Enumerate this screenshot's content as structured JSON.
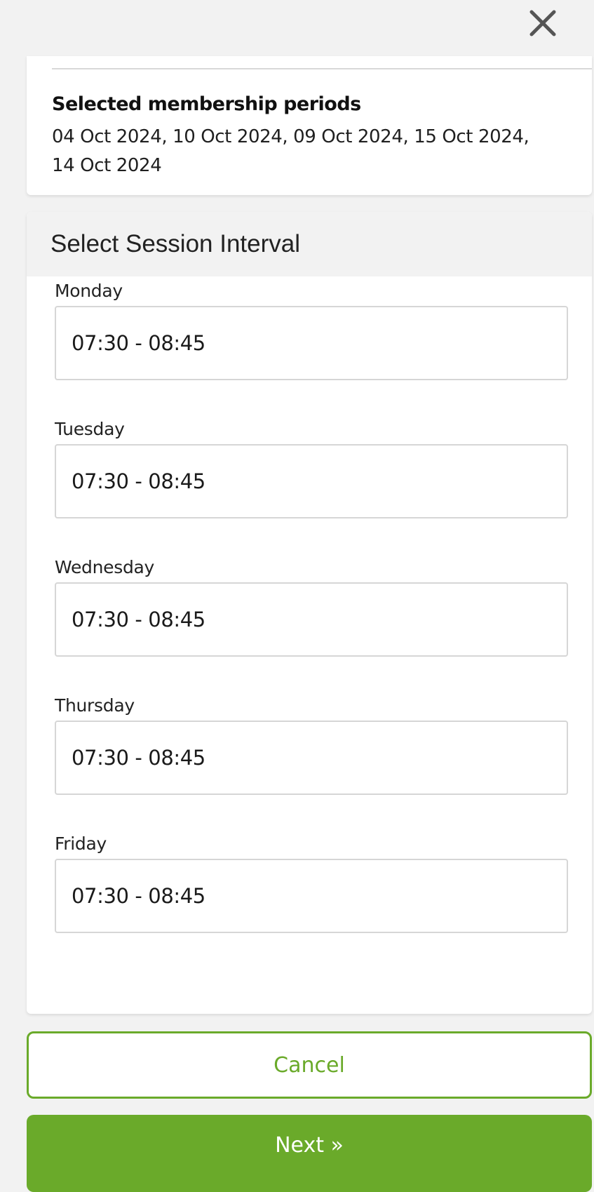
{
  "header": {
    "close_icon": "close-icon"
  },
  "membership": {
    "title": "Selected membership periods",
    "periods_line1": "04 Oct 2024, 10 Oct 2024, 09 Oct 2024, 15 Oct 2024,",
    "periods_line2": "14 Oct 2024"
  },
  "sessions": {
    "title": "Select Session Interval",
    "days": [
      {
        "label": "Monday",
        "value": "07:30 - 08:45"
      },
      {
        "label": "Tuesday",
        "value": "07:30 - 08:45"
      },
      {
        "label": "Wednesday",
        "value": "07:30 - 08:45"
      },
      {
        "label": "Thursday",
        "value": "07:30 - 08:45"
      },
      {
        "label": "Friday",
        "value": "07:30 - 08:45"
      }
    ]
  },
  "actions": {
    "cancel_label": "Cancel",
    "next_label": "Next »"
  },
  "colors": {
    "accent": "#6aaa2a",
    "header_bg": "#f2f2f2",
    "border": "#d6d6d6"
  }
}
